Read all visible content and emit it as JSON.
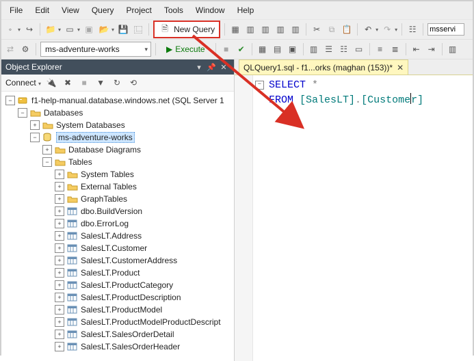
{
  "menu": [
    "File",
    "Edit",
    "View",
    "Query",
    "Project",
    "Tools",
    "Window",
    "Help"
  ],
  "toolbar1": {
    "new_query": "New Query",
    "host_input": "msservi"
  },
  "toolbar2": {
    "db_combo": "ms-adventure-works",
    "execute": "Execute"
  },
  "explorer": {
    "title": "Object Explorer",
    "connect": "Connect",
    "server": "f1-help-manual.database.windows.net (SQL Server 1",
    "databases": "Databases",
    "system_databases": "System Databases",
    "db": "ms-adventure-works",
    "database_diagrams": "Database Diagrams",
    "tables_folder": "Tables",
    "system_tables": "System Tables",
    "external_tables": "External Tables",
    "graph_tables": "GraphTables",
    "tables": [
      "dbo.BuildVersion",
      "dbo.ErrorLog",
      "SalesLT.Address",
      "SalesLT.Customer",
      "SalesLT.CustomerAddress",
      "SalesLT.Product",
      "SalesLT.ProductCategory",
      "SalesLT.ProductDescription",
      "SalesLT.ProductModel",
      "SalesLT.ProductModelProductDescript",
      "SalesLT.SalesOrderDetail",
      "SalesLT.SalesOrderHeader"
    ]
  },
  "tab": {
    "label": "QLQuery1.sql - f1...orks (maghan (153))*"
  },
  "code": {
    "select_kw": "SELECT",
    "star": "*",
    "from_kw": "FROM",
    "schema": "[SalesLT]",
    "dot": ".",
    "object_a": "[Custome",
    "object_b": "r]"
  }
}
